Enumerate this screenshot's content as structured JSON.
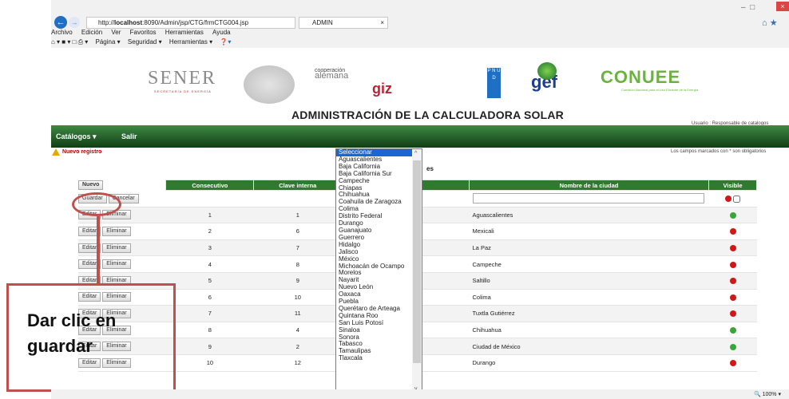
{
  "browser": {
    "url_prefix": "http://",
    "url_host": "localhost",
    "url_rest": ":8090/Admin/jsp/CTG/frmCTG004.jsp",
    "tab_title": "ADMIN",
    "zoom": "100%",
    "menu": [
      "Archivo",
      "Edición",
      "Ver",
      "Favoritos",
      "Herramientas",
      "Ayuda"
    ],
    "cmd": [
      "Página ▾",
      "Seguridad ▾",
      "Herramientas ▾"
    ]
  },
  "header": {
    "sener": "SENER",
    "sener_sub": "SECRETARÍA DE ENERGÍA",
    "alemana_small": "cooperación",
    "alemana_big": "alemana",
    "giz": "giz",
    "pnud": "P N U D",
    "gef": "gef",
    "conuee": "CONUEE",
    "conuee_sub": "Comisión Nacional para el Uso Eficiente de la Energía",
    "title": "ADMINISTRACIÓN DE LA CALCULADORA SOLAR",
    "usuario": "Usuario : Responsable de catalogos"
  },
  "nav": {
    "catalogos": "Catálogos ▾",
    "salir": "Salir"
  },
  "page": {
    "nuevo_registro": "Nuevo registro",
    "campos_note": "Los campos marcados con * son obligatorios",
    "section_title": "es"
  },
  "table": {
    "headers": {
      "nuevo": "Nuevo",
      "consecutivo": "Consecutivo",
      "clave": "Clave interna",
      "ciudad": "Nombre de la ciudad",
      "visible": "Visible"
    },
    "guardar": "Guardar",
    "cancelar": "Cancelar",
    "editar": "Editar",
    "eliminar": "Eliminar",
    "rows": [
      {
        "consecutivo": "1",
        "clave": "1",
        "ciudad": "Aguascalientes",
        "visible": "green"
      },
      {
        "consecutivo": "2",
        "clave": "6",
        "ciudad": "Mexicali",
        "visible": "red"
      },
      {
        "consecutivo": "3",
        "clave": "7",
        "ciudad": "La Paz",
        "visible": "red"
      },
      {
        "consecutivo": "4",
        "clave": "8",
        "ciudad": "Campeche",
        "visible": "red"
      },
      {
        "consecutivo": "5",
        "clave": "9",
        "ciudad": "Saltillo",
        "visible": "red"
      },
      {
        "consecutivo": "6",
        "clave": "10",
        "ciudad": "Colima",
        "visible": "red"
      },
      {
        "consecutivo": "7",
        "clave": "11",
        "ciudad": "Tuxtla Gutiérrez",
        "visible": "red"
      },
      {
        "consecutivo": "8",
        "clave": "4",
        "ciudad": "Chihuahua",
        "visible": "green"
      },
      {
        "consecutivo": "9",
        "clave": "2",
        "ciudad": "Ciudad de México",
        "visible": "green"
      },
      {
        "consecutivo": "10",
        "clave": "12",
        "ciudad": "Durango",
        "visible": "red"
      }
    ]
  },
  "dropdown": {
    "options": [
      "Seleccionar",
      "Aguascalientes",
      "Baja California",
      "Baja California Sur",
      "Campeche",
      "Chiapas",
      "Chihuahua",
      "Coahuila de Zaragoza",
      "Colima",
      "Distrito Federal",
      "Durango",
      "Guanajuato",
      "Guerrero",
      "Hidalgo",
      "Jalisco",
      "México",
      "Michoacán de Ocampo",
      "Morelos",
      "Nayarit",
      "Nuevo León",
      "Oaxaca",
      "Puebla",
      "Querétaro de Arteaga",
      "Quintana Roo",
      "San Luis Potosí",
      "Sinaloa",
      "Sonora",
      "Tabasco",
      "Tamaulipas",
      "Tlaxcala"
    ],
    "selected": "Seleccionar"
  },
  "callout": {
    "line1": "Dar  clic  en",
    "line2": "guardar"
  },
  "colors": {
    "accent_green": "#2f7a2f",
    "highlight": "#c0504d"
  }
}
